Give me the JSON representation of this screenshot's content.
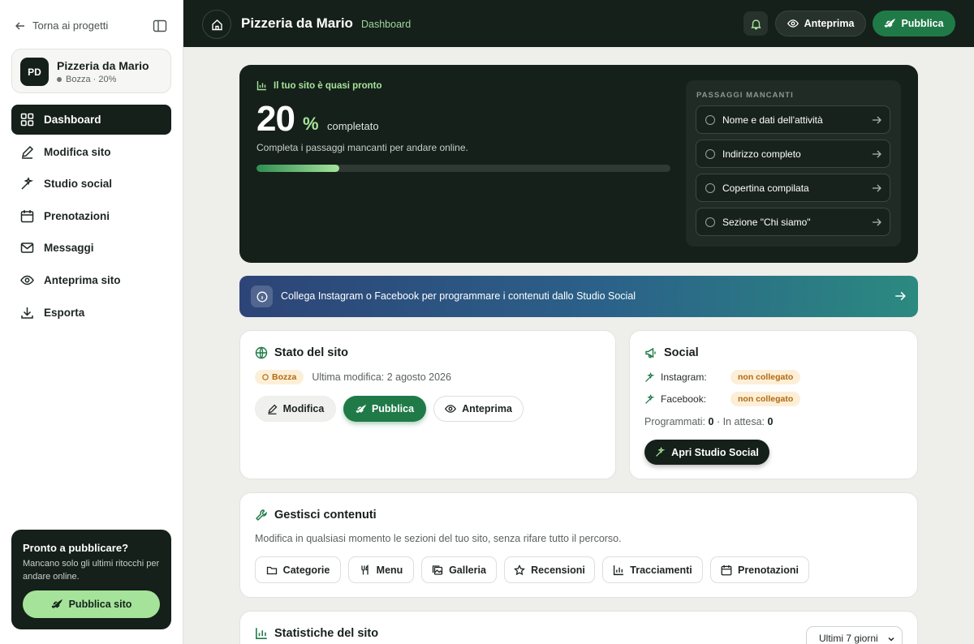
{
  "sidebar": {
    "back_label": "Torna ai progetti",
    "project": {
      "initials": "PD",
      "name": "Pizzeria da Mario",
      "status": "Bozza · 20%"
    },
    "nav": [
      {
        "label": "Dashboard",
        "icon": "grid-icon",
        "active": true
      },
      {
        "label": "Modifica sito",
        "icon": "pencil-icon",
        "active": false
      },
      {
        "label": "Studio social",
        "icon": "sparkle-icon",
        "active": false
      },
      {
        "label": "Prenotazioni",
        "icon": "calendar-icon",
        "active": false
      },
      {
        "label": "Messaggi",
        "icon": "mail-icon",
        "active": false
      },
      {
        "label": "Anteprima sito",
        "icon": "eye-icon",
        "active": false
      },
      {
        "label": "Esporta",
        "icon": "download-icon",
        "active": false
      }
    ],
    "publish_card": {
      "title": "Pronto a pubblicare?",
      "description": "Mancano solo gli ultimi ritocchi per andare online.",
      "button_label": "Pubblica sito"
    }
  },
  "header": {
    "title": "Pizzeria da Mario",
    "subtitle": "Dashboard",
    "preview_label": "Anteprima",
    "publish_label": "Pubblica"
  },
  "progress": {
    "label": "Il tuo sito è quasi pronto",
    "percent_value": "20",
    "percent_sign": "%",
    "percent_word": "completato",
    "percent_fraction": 0.2,
    "description": "Completa i passaggi mancanti per andare online.",
    "missing_title": "PASSAGGI MANCANTI",
    "missing_steps": [
      "Nome e dati dell'attività",
      "Indirizzo completo",
      "Copertina compilata",
      "Sezione \"Chi siamo\""
    ]
  },
  "banner": {
    "text": "Collega Instagram o Facebook per programmare i contenuti dallo Studio Social"
  },
  "site_status": {
    "title": "Stato del sito",
    "badge": "Bozza",
    "last_modified": "Ultima modifica: 2 agosto 2026",
    "edit_label": "Modifica",
    "publish_label": "Pubblica",
    "preview_label": "Anteprima"
  },
  "social": {
    "title": "Social",
    "instagram_label": "Instagram:",
    "instagram_status": "non collegato",
    "facebook_label": "Facebook:",
    "facebook_status": "non collegato",
    "scheduled_label": "Programmati:",
    "scheduled_value": "0",
    "pending_label": "· In attesa:",
    "pending_value": "0",
    "open_studio_label": "Apri Studio Social"
  },
  "content": {
    "title": "Gestisci contenuti",
    "description": "Modifica in qualsiasi momento le sezioni del tuo sito, senza rifare tutto il percorso.",
    "chips": [
      "Categorie",
      "Menu",
      "Galleria",
      "Recensioni",
      "Tracciamenti",
      "Prenotazioni"
    ]
  },
  "stats": {
    "title": "Statistiche del sito",
    "range_selected": "Ultimi 7 giorni"
  },
  "colors": {
    "dark": "#15201a",
    "accent_green": "#1f7a47",
    "lime": "#a6e39a",
    "draft_badge": "#fdefd7"
  }
}
